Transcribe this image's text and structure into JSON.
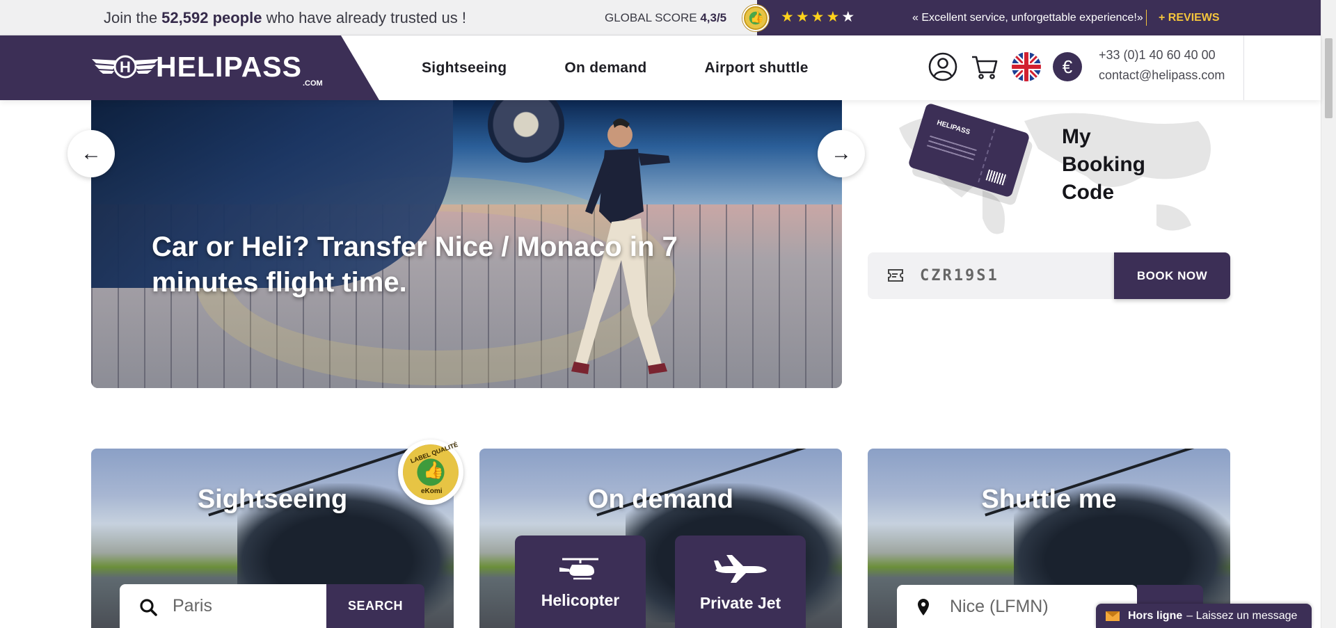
{
  "topbar": {
    "join_prefix": "Join the ",
    "join_count": "52,592 people",
    "join_suffix": " who have already trusted us !",
    "score_label": "GLOBAL SCORE ",
    "score_value": "4,3/5",
    "stars_full": "★★★★",
    "stars_last": "★",
    "quote": "« Excellent service, unforgettable experience!»",
    "reviews_link": "+ REVIEWS"
  },
  "header": {
    "logo_text": "HELIPASS",
    "logo_domain": ".COM",
    "nav": [
      {
        "label": "Sightseeing"
      },
      {
        "label": "On demand"
      },
      {
        "label": "Airport shuttle"
      }
    ],
    "currency_symbol": "€",
    "phone": "+33 (0)1 40 60 40 00",
    "email": "contact@helipass.com"
  },
  "hero": {
    "title": "Car or Heli? Transfer Nice / Monaco in 7 minutes flight time.",
    "prev_symbol": "←",
    "next_symbol": "→"
  },
  "booking": {
    "ticket_brand": "HELIPASS",
    "title": "My Booking Code",
    "code_value": "CZR19S1",
    "button": "BOOK NOW"
  },
  "cards": {
    "sightseeing": {
      "title": "Sightseeing",
      "search_value": "Paris",
      "search_button": "SEARCH"
    },
    "on_demand": {
      "title": "On demand",
      "modes": [
        {
          "label": "Helicopter"
        },
        {
          "label": "Private Jet"
        }
      ]
    },
    "shuttle": {
      "title": "Shuttle me",
      "airport_value": "Nice (LFMN)"
    }
  },
  "ekomi": {
    "top_text": "LABEL QUALITÉ",
    "bottom_text": "eKomi"
  },
  "chat": {
    "status": "Hors ligne",
    "message": "– Laissez un message"
  },
  "colors": {
    "brand_purple": "#3c2f56",
    "accent_yellow": "#f4c53c",
    "star_yellow": "#ffd21c"
  },
  "icons": {
    "account": "user-circle-icon",
    "cart": "cart-icon",
    "language": "uk-flag-icon",
    "currency": "euro-icon",
    "ticket": "ticket-icon",
    "search": "search-icon",
    "location": "map-pin-icon",
    "helicopter": "helicopter-icon",
    "jet": "private-jet-icon",
    "chat": "envelope-icon"
  }
}
